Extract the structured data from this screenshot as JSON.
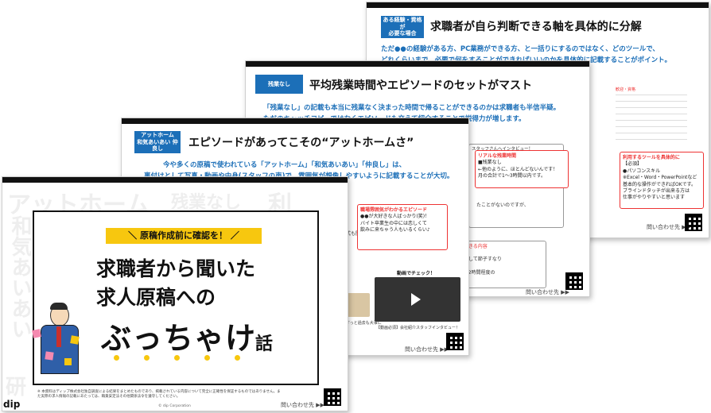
{
  "slide4": {
    "tag": "ある経験・資格が\n必要な場合",
    "title": "求職者が自ら判断できる軸を具体的に分解",
    "body": "ただ●●の経験がある方、PC業務ができる方、と一括りにするのではなく、どのツールで、",
    "body2": "どれくらいまで、必要で何をすることができればいいのかを具体的に記載することがポイント。",
    "label_small": "歓迎・資格",
    "red_label": "利用するツールを具体的に",
    "red_lines": [
      "【必須】",
      "●パソコンスキル",
      "※Excel・Word・PowerPointなど",
      "基本的な操作ができればOKです。",
      "ブラインドタッチが出来る方は",
      "仕事がやりやすいと思います"
    ],
    "contact": "問い合わせ先 ▶▶"
  },
  "slide3": {
    "tag": "残業なし",
    "title": "平均残業時間やエピソードのセットがマスト",
    "body": "「残業なし」の記載も本当に残業なく決まった時間で帰ることができるのかは求職者も半信半疑。",
    "body2": "ただのキャッチコピーではなくエピソードも交えて紹介することで説得力が増します。",
    "card_title": "スタッフさんへインタビュー！",
    "red_label": "リアルな残業時間",
    "red_lines": [
      "■残業なし",
      "←他のように、ほとんどないんです！",
      "月の合計で1～3時間以内です。"
    ],
    "frag1": "たことがないのですが、",
    "frag2": "ージできる内容",
    "frag3": "づけとして節子すなり",
    "frag4": "理は1.2時間程度の",
    "contact": "問い合わせ先 ▶▶"
  },
  "slide2": {
    "tag": "アットホーム\n和気あいあい 仲良し",
    "title": "エピソードがあってこその“アットホームさ”",
    "body": "今や多くの原稿で使われている「アットホーム」「和気あいあい」「仲良し」は、",
    "body2": "裏付けとして写真・動画や中身(スタッフの声)で、雰囲気が想像しやすいように記載することが大切。",
    "red_label": "職場雰囲気がわかるエピソード",
    "red_lines": [
      "●●が大好きな人ばっかり(笑)！",
      "バイト卒業生の中には恋しくて",
      "飲みに来ちゃう人もいるくらい♪"
    ],
    "video_label": "動画でチェック！",
    "video_caption": "【動画必須】会社紹介スタッフインタビュー！",
    "frag1": "式も開催",
    "frag2": "すっと過去も大事に",
    "contact": "問い合わせ先 ▶▶"
  },
  "cover": {
    "bg1": "アットホーム",
    "bg2": "残業なし",
    "bg3": "利",
    "bg4": "和気あいあい",
    "bg5": "の",
    "bg6": "研",
    "ribbon": "＼ 原稿作成前に確認を！ ／",
    "line1": "求職者から聞いた",
    "line2": "求人原稿への",
    "line3": "ぶっちゃけ",
    "line3b": "話",
    "footnote": "※ 本資料はディップ株式会社独自調査による結果をまとめたものであり、掲載されている内容について完全に正確性を保証するものではありません。また実際の求人情報の記載にあたっては、職業安定法その他関係法令を遵守してください。",
    "copyright": "© dip Corporation",
    "contact": "問い合わせ先 ▶▶",
    "logo": "dip"
  }
}
